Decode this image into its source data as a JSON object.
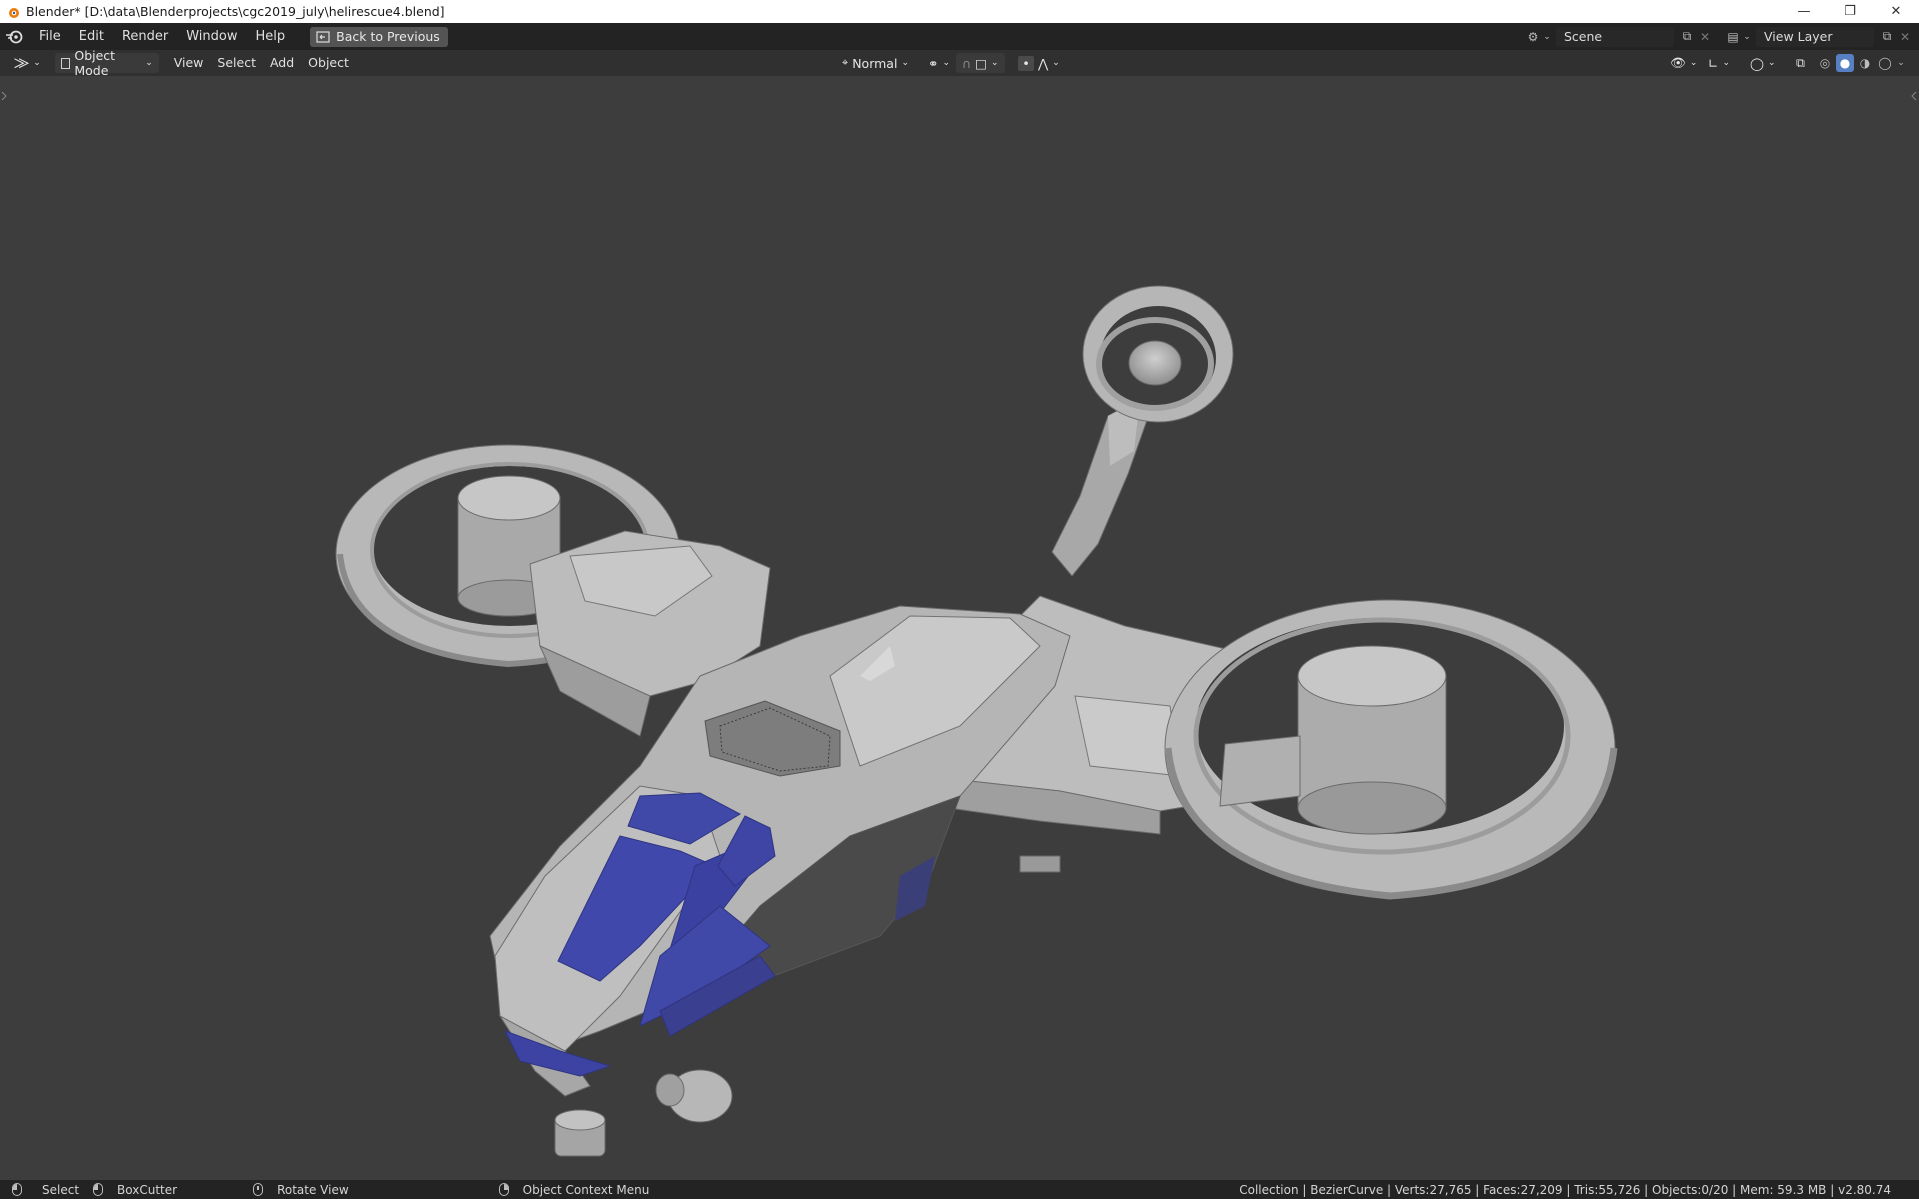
{
  "window": {
    "title": "Blender* [D:\\data\\Blenderprojects\\cgc2019_july\\helirescue4.blend]",
    "controls": [
      "minimize-icon",
      "restore-icon",
      "close-icon"
    ]
  },
  "menubar": {
    "items": [
      "File",
      "Edit",
      "Render",
      "Window",
      "Help"
    ],
    "back_button": "Back to Previous",
    "scene_name": "Scene",
    "view_layer_name": "View Layer"
  },
  "viewport_header": {
    "mode": "Object Mode",
    "menus": [
      "View",
      "Select",
      "Add",
      "Object"
    ],
    "transform_orientation": "Normal",
    "shading_modes": [
      "wireframe",
      "solid",
      "material-preview",
      "rendered"
    ],
    "active_shading": "solid"
  },
  "statusbar": {
    "select": "Select",
    "tool": "BoxCutter",
    "rotate": "Rotate View",
    "context": "Object Context Menu",
    "stats": "Collection | BezierCurve | Verts:27,765 | Faces:27,209 | Tris:55,726 | Objects:0/20 | Mem: 59.3 MB | v2.80.74"
  },
  "colors": {
    "viewport_bg": "#3d3d3d",
    "model_grey": "#b4b4b4",
    "window_blue": "#4048a8",
    "header_bg": "#303030",
    "menubar_bg": "#232323"
  }
}
